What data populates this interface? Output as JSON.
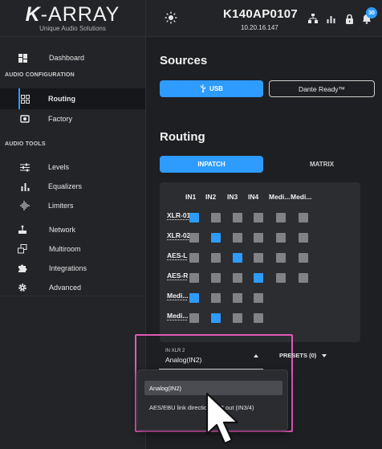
{
  "brand": {
    "logo_bold": "K",
    "logo_rest": "-ARRAY",
    "tagline": "Unique Audio Solutions"
  },
  "header": {
    "device_name": "K140AP0107",
    "device_ip": "10.20.16.147",
    "notification_count": "30"
  },
  "sidebar": {
    "dashboard": "Dashboard",
    "section_audio_config": "AUDIO CONFIGURATION",
    "routing": "Routing",
    "factory": "Factory",
    "section_audio_tools": "AUDIO TOOLS",
    "levels": "Levels",
    "equalizers": "Equalizers",
    "limiters": "Limiters",
    "network": "Network",
    "multiroom": "Multiroom",
    "integrations": "Integrations",
    "advanced": "Advanced"
  },
  "sources": {
    "title": "Sources",
    "usb": "USB",
    "dante": "Dante Ready™"
  },
  "routing": {
    "title": "Routing",
    "tab_inpatch": "INPATCH",
    "tab_matrix": "MATRIX",
    "columns": [
      "IN1",
      "IN2",
      "IN3",
      "IN4",
      "Medi...",
      "Medi..."
    ],
    "rows": [
      {
        "label": "XLR-01",
        "cells": [
          1,
          0,
          0,
          0,
          0,
          0
        ]
      },
      {
        "label": "XLR-02",
        "cells": [
          0,
          1,
          0,
          0,
          0,
          0
        ]
      },
      {
        "label": "AES-L",
        "cells": [
          0,
          0,
          1,
          0,
          0,
          0
        ]
      },
      {
        "label": "AES-R",
        "cells": [
          0,
          0,
          0,
          1,
          0,
          0
        ]
      },
      {
        "label": "Medi...",
        "cells": [
          1,
          0,
          0,
          0
        ]
      },
      {
        "label": "Medi...",
        "cells": [
          0,
          1,
          0,
          0
        ]
      }
    ]
  },
  "input_select": {
    "label": "IN XLR 2",
    "value": "Analog(IN2)",
    "options": [
      "Analog(IN2)",
      "AES/EBU link direction XLR out (IN3/4)"
    ]
  },
  "presets": {
    "label": "PRESETS (0)"
  },
  "colors": {
    "accent": "#2e9bff",
    "highlight": "#e259b7",
    "cell_off": "#808285"
  }
}
